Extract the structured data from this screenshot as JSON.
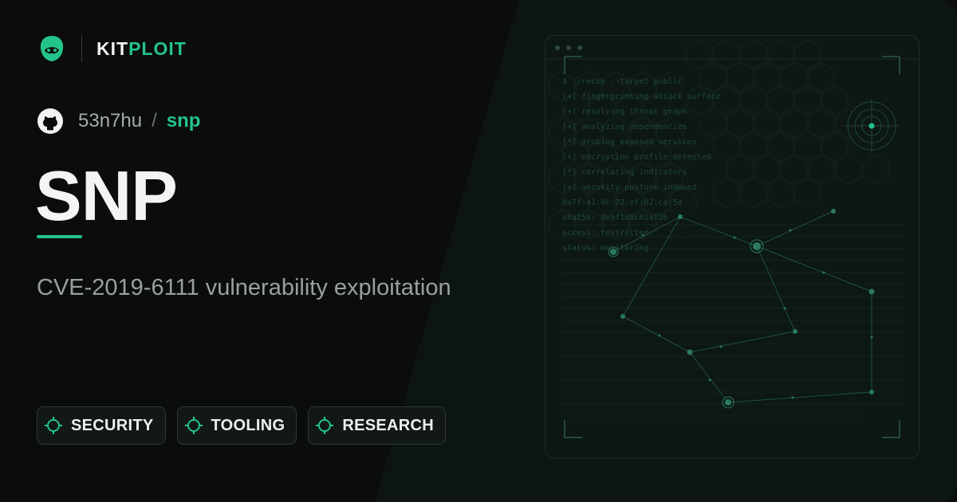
{
  "brand": {
    "name_part1": "KIT",
    "name_part2": "PLOIT",
    "logo_icon": "hacker-mask-icon"
  },
  "repo": {
    "owner": "53n7hu",
    "separator": "/",
    "name": "snp",
    "icon": "github-icon"
  },
  "title": "SNP",
  "description": "CVE-2019-6111 vulnerability exploitation",
  "tags": [
    {
      "label": "SECURITY",
      "icon": "crosshair-icon"
    },
    {
      "label": "TOOLING",
      "icon": "crosshair-icon"
    },
    {
      "label": "RESEARCH",
      "icon": "crosshair-icon"
    }
  ],
  "terminal": {
    "lines": [
      "$ ./recon --target public",
      "[+] fingerprinting attack surface",
      "[+] resolving threat graph",
      "[+] analyzing dependencies",
      "[*] probing exposed services",
      "[+] encryption profile detected",
      "[*] correlating indicators",
      "[+] security posture indexed",
      "0x7f:a1:9c:22:ef:02:ca:5d",
      "sha256: 4e9f1d8c01af2b",
      "access: restricted",
      "status: monitoring"
    ]
  },
  "colors": {
    "accent": "#23c48a",
    "background": "#0a0b0b",
    "text": "#f4f4f4",
    "muted": "#9aa0a0"
  }
}
